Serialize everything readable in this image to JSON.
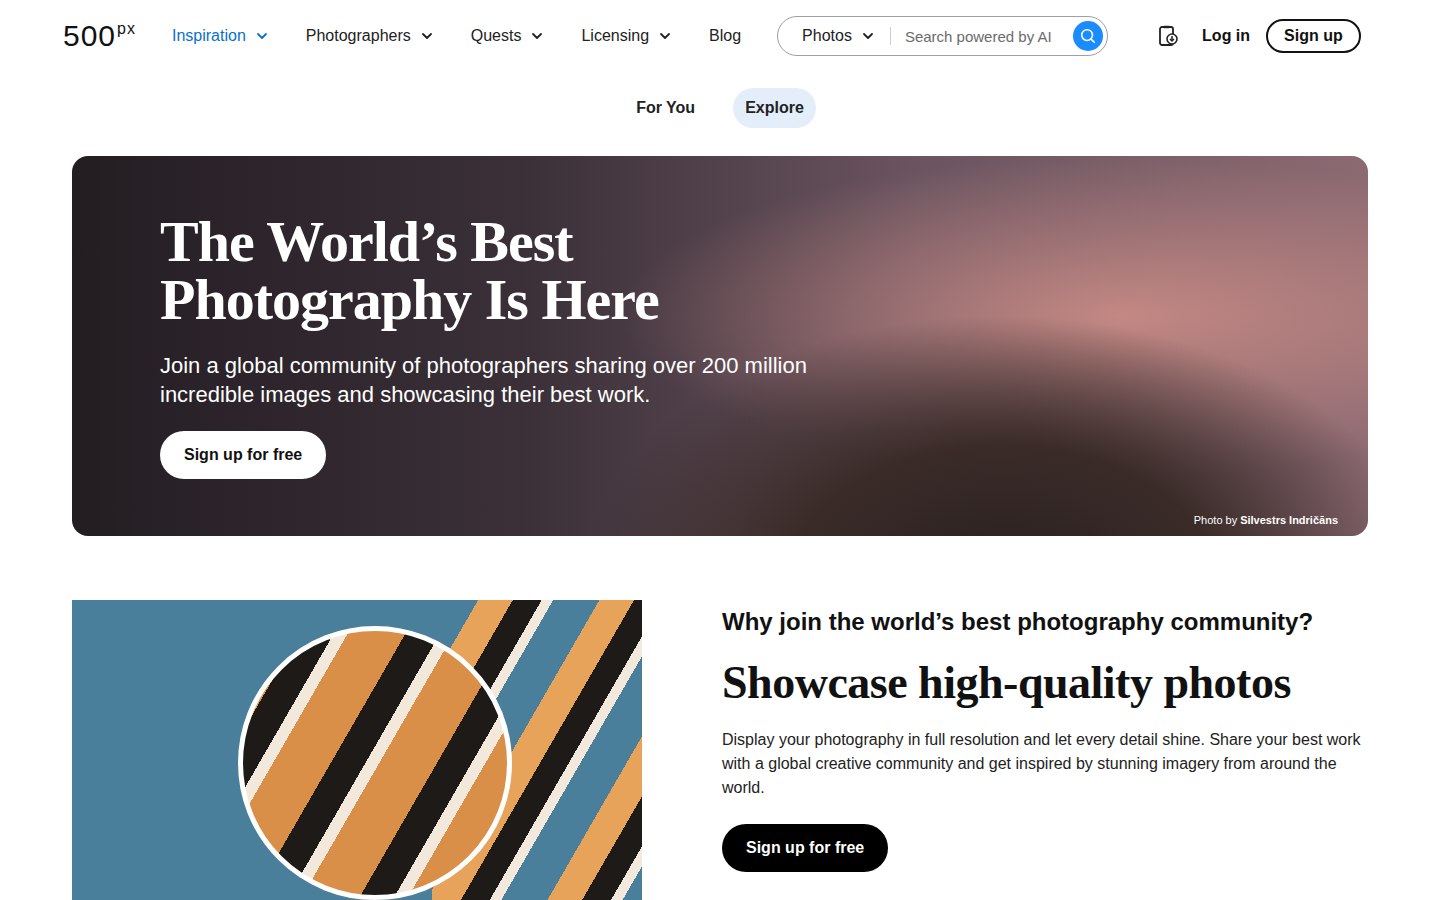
{
  "logo": {
    "main": "500",
    "sup": "px"
  },
  "nav": [
    {
      "label": "Inspiration",
      "kind": "dropdown",
      "selected": true
    },
    {
      "label": "Photographers",
      "kind": "dropdown",
      "selected": false
    },
    {
      "label": "Quests",
      "kind": "dropdown",
      "selected": false
    },
    {
      "label": "Licensing",
      "kind": "dropdown",
      "selected": false
    },
    {
      "label": "Blog",
      "kind": "link",
      "selected": false
    }
  ],
  "search": {
    "scope": "Photos",
    "placeholder": "Search powered by AI"
  },
  "auth": {
    "login": "Log in",
    "signup": "Sign up"
  },
  "subtabs": [
    {
      "label": "For You",
      "selected": false
    },
    {
      "label": "Explore",
      "selected": true
    }
  ],
  "hero": {
    "title_lines": [
      "The World’s Best",
      "Photography Is Here"
    ],
    "subtitle": "Join a global community of photographers sharing over 200 million incredible images and showcasing their best work.",
    "button": "Sign up for free",
    "credit": {
      "prefix": "Photo by",
      "author": "Silvestrs Indričāns"
    }
  },
  "feature": {
    "kicker": "Why join the world’s best photography community?",
    "title": "Showcase high-quality photos",
    "body": "Display your photography in full resolution and let every detail shine. Share your best work with a global creative community and get inspired by stunning imagery from around the world.",
    "button": "Sign up for free"
  }
}
